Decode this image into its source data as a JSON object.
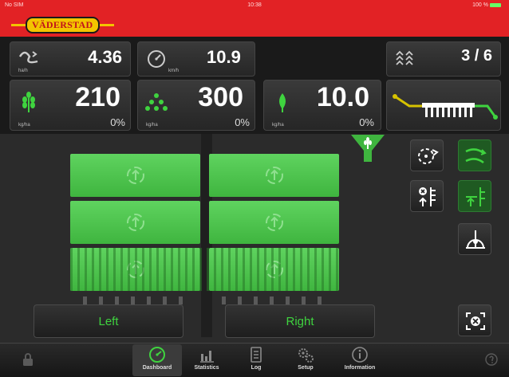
{
  "status_bar": {
    "carrier": "No SIM",
    "time": "10:38",
    "battery": "100 %"
  },
  "brand": {
    "logo": "VÄDERSTAD"
  },
  "metrics": {
    "area_rate": {
      "value": "4.36",
      "unit": "ha/h",
      "icon": "area-rate-icon"
    },
    "speed": {
      "value": "10.9",
      "unit": "km/h",
      "icon": "speedometer-icon"
    },
    "tramlines": {
      "value": "3 / 6",
      "icon": "tramline-icon"
    },
    "seed": {
      "value": "210",
      "unit": "kg/ha",
      "deviation": "0%",
      "icon": "seed-icon"
    },
    "fertilizer": {
      "value": "300",
      "unit": "kg/ha",
      "deviation": "0%",
      "icon": "fertilizer-icon"
    },
    "microgranule": {
      "value": "10.0",
      "unit": "kg/ha",
      "deviation": "0%",
      "icon": "drop-seed-icon"
    }
  },
  "sections": {
    "left_label": "Left",
    "right_label": "Right"
  },
  "side_buttons": [
    {
      "name": "rotate-metering-icon"
    },
    {
      "name": "tramline-shift-icon"
    },
    {
      "name": "marker-lift-icon"
    },
    {
      "name": "marker-lower-icon"
    },
    {
      "name": "calibration-icon"
    },
    {
      "name": "reset-sections-icon"
    }
  ],
  "tabs": [
    {
      "label": "Dashboard",
      "icon": "dashboard-icon"
    },
    {
      "label": "Statistics",
      "icon": "statistics-icon"
    },
    {
      "label": "Log",
      "icon": "log-icon"
    },
    {
      "label": "Setup",
      "icon": "setup-icon"
    },
    {
      "label": "Information",
      "icon": "information-icon"
    }
  ],
  "colors": {
    "brand_red": "#e22225",
    "brand_yellow": "#f3c400",
    "active_green": "#3fb53f",
    "label_green": "#3fd33f"
  }
}
